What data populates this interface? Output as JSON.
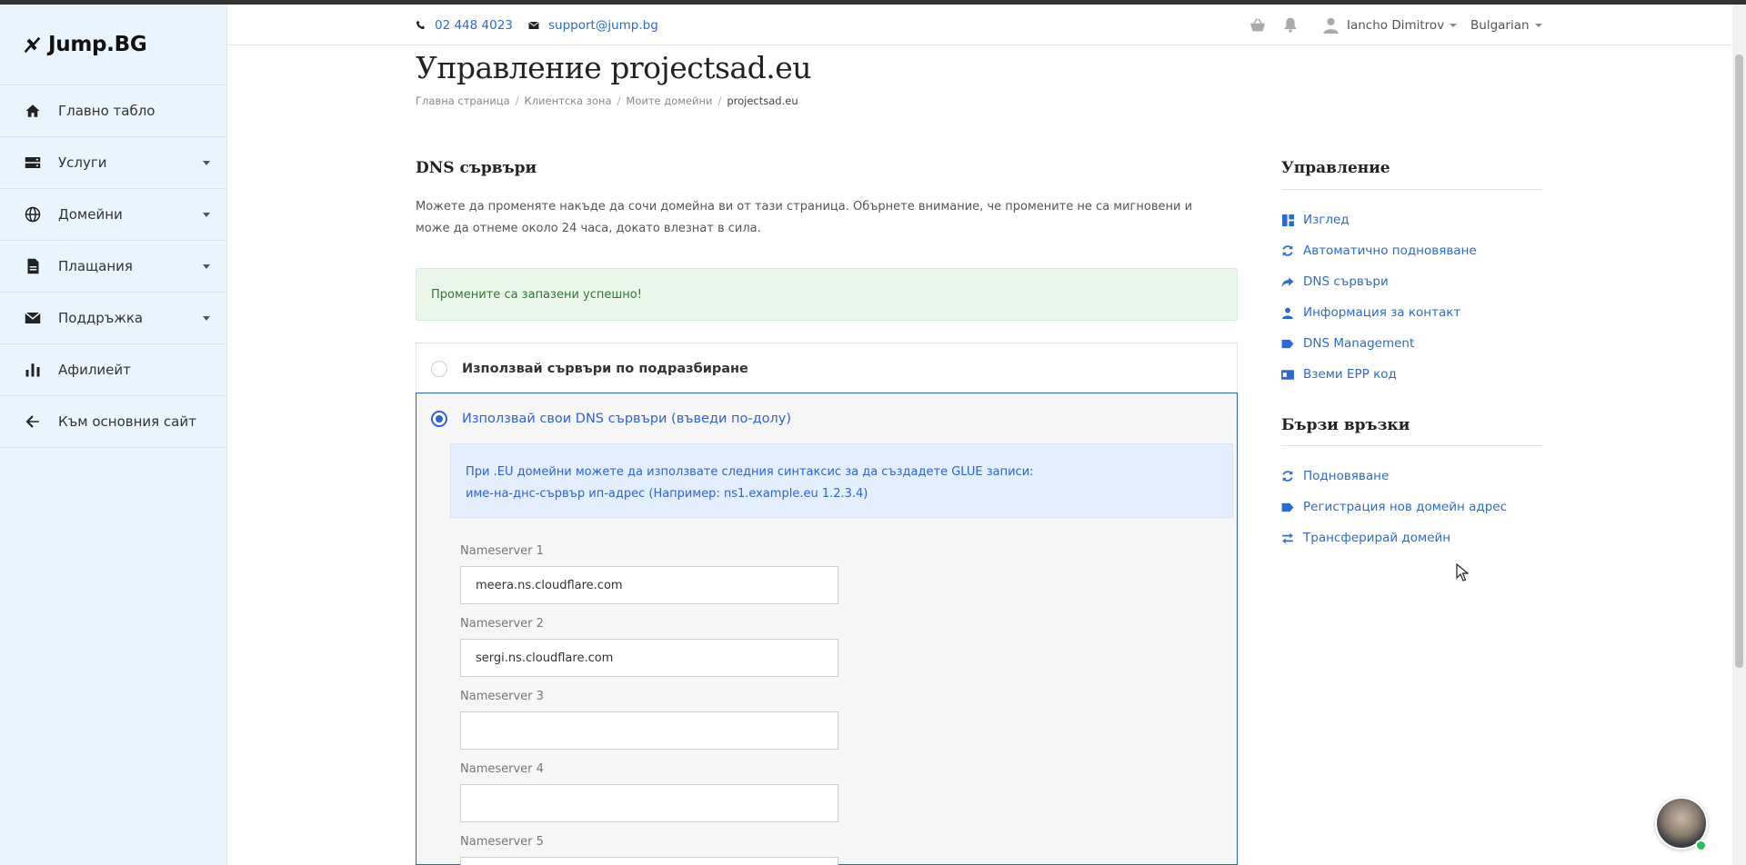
{
  "brand": {
    "name": "Jump.BG"
  },
  "sidebar": {
    "items": [
      {
        "label": "Главно табло",
        "icon": "home-icon",
        "has_caret": false
      },
      {
        "label": "Услуги",
        "icon": "server-icon",
        "has_caret": true
      },
      {
        "label": "Домейни",
        "icon": "globe-icon",
        "has_caret": true
      },
      {
        "label": "Плащания",
        "icon": "invoice-icon",
        "has_caret": true
      },
      {
        "label": "Поддръжка",
        "icon": "envelope-icon",
        "has_caret": true
      },
      {
        "label": "Афилиейт",
        "icon": "bar-chart-icon",
        "has_caret": false
      },
      {
        "label": "Към основния сайт",
        "icon": "arrow-left-icon",
        "has_caret": false
      }
    ]
  },
  "topbar": {
    "phone": "02 448 4023",
    "email": "support@jump.bg",
    "user": "Iancho Dimitrov",
    "language": "Bulgarian"
  },
  "page": {
    "title": "Управление projectsad.eu",
    "breadcrumb": [
      "Главна страница",
      "Клиентска зона",
      "Моите домейни",
      "projectsad.eu"
    ]
  },
  "dns": {
    "section_title": "DNS сървъри",
    "description": "Можете да променяте накъде да сочи домейна ви от тази страница. Обърнете внимание, че промените не са мигновени и може да отнеме около 24 часа, докато влезнат в сила.",
    "success_message": "Промените са запазени успешно!",
    "option_default": "Използвай сървъри по подразбиране",
    "option_custom": "Използвай свои DNS сървъри (въведи по-долу)",
    "info_line1": "При .EU домейни можете да използвате следния синтаксис за да създадете GLUE записи:",
    "info_line2": "име-на-днс-сървър ип-адрес (Например: ns1.example.eu 1.2.3.4)",
    "nameservers": [
      {
        "label": "Nameserver 1",
        "value": "meera.ns.cloudflare.com"
      },
      {
        "label": "Nameserver 2",
        "value": "sergi.ns.cloudflare.com"
      },
      {
        "label": "Nameserver 3",
        "value": ""
      },
      {
        "label": "Nameserver 4",
        "value": ""
      },
      {
        "label": "Nameserver 5",
        "value": ""
      }
    ]
  },
  "right_panel": {
    "manage_title": "Управление",
    "manage_links": [
      {
        "label": "Изглед",
        "icon": "dashboard-icon"
      },
      {
        "label": "Автоматично подновяване",
        "icon": "sync-icon"
      },
      {
        "label": "DNS сървъри",
        "icon": "share-arrow-icon"
      },
      {
        "label": "Информация за контакт",
        "icon": "user-icon"
      },
      {
        "label": "DNS Management",
        "icon": "tag-icon"
      },
      {
        "label": "Вземи EPP код",
        "icon": "id-card-icon"
      }
    ],
    "quick_title": "Бързи връзки",
    "quick_links": [
      {
        "label": "Подновяване",
        "icon": "sync-icon"
      },
      {
        "label": "Регистрация нов домейн адрес",
        "icon": "tag-icon"
      },
      {
        "label": "Трансферирай домейн",
        "icon": "exchange-icon"
      }
    ]
  },
  "colors": {
    "accent": "#2e62d9",
    "link": "#2a6bd1",
    "sidebar_bg": "#eaf4fc",
    "success_text": "#2f7a2f"
  }
}
